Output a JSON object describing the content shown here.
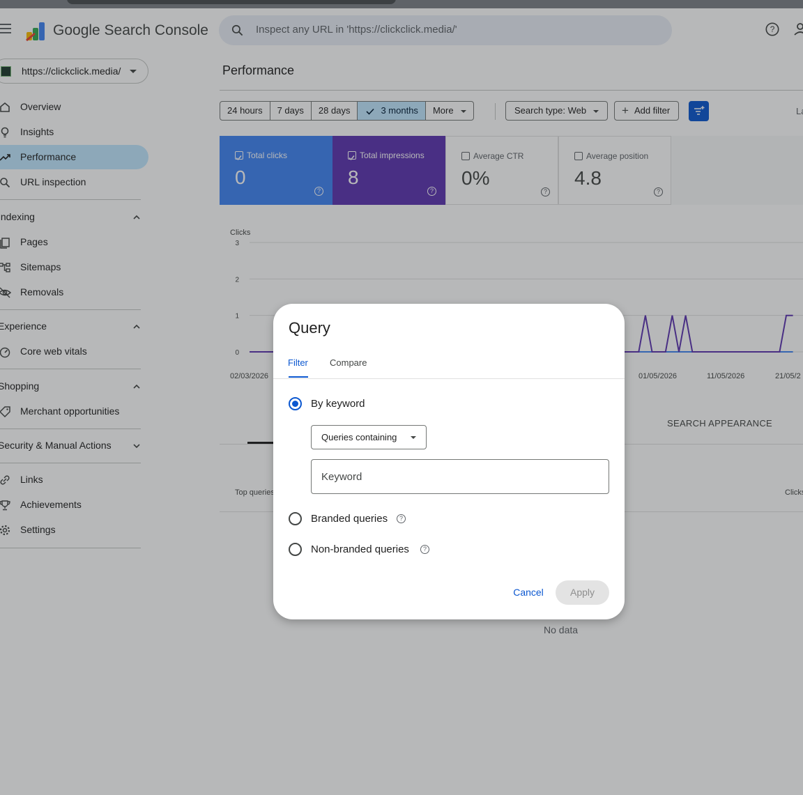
{
  "header": {
    "brand": "Google Search Console",
    "search_placeholder": "Inspect any URL in 'https://clickclick.media/'"
  },
  "sidebar": {
    "property": "https://clickclick.media/",
    "items": [
      {
        "label": "Overview",
        "icon": "home-icon"
      },
      {
        "label": "Insights",
        "icon": "lightbulb-icon"
      },
      {
        "label": "Performance",
        "icon": "trending-up-icon",
        "active": true
      },
      {
        "label": "URL inspection",
        "icon": "search-icon"
      }
    ],
    "sections": [
      {
        "title": "Indexing",
        "items": [
          "Pages",
          "Sitemaps",
          "Removals"
        ]
      },
      {
        "title": "Experience",
        "items": [
          "Core web vitals"
        ]
      },
      {
        "title": "Shopping",
        "items": [
          "Merchant opportunities"
        ]
      },
      {
        "title": "Security & Manual Actions",
        "items": []
      }
    ],
    "bottom_items": [
      "Links",
      "Achievements",
      "Settings"
    ]
  },
  "main": {
    "title": "Performance",
    "ranges": [
      "24 hours",
      "7 days",
      "28 days",
      "3 months",
      "More"
    ],
    "selected_range": "3 months",
    "search_type": "Search type: Web",
    "add_filter": "Add filter",
    "last_updated_partial": "La",
    "metrics": [
      {
        "label": "Total clicks",
        "value": "0",
        "checked": true,
        "color": "#4285f4"
      },
      {
        "label": "Total impressions",
        "value": "8",
        "checked": true,
        "color": "#5e35b1"
      },
      {
        "label": "Average CTR",
        "value": "0%",
        "checked": false
      },
      {
        "label": "Average position",
        "value": "4.8",
        "checked": false
      }
    ]
  },
  "chart_data": {
    "type": "line",
    "ylabel": "Clicks",
    "ylim": [
      0,
      3
    ],
    "y_ticks": [
      "0",
      "1",
      "2",
      "3"
    ],
    "x_tick_labels": [
      "02/03/2026",
      "01/05/2026",
      "11/05/2026",
      "21/05/2"
    ],
    "series": [
      {
        "color": "#5e35b1",
        "points": [
          [
            "02/03/2026",
            0
          ],
          [
            "29/04/2026",
            0
          ],
          [
            "30/04/2026",
            1
          ],
          [
            "01/05/2026",
            0
          ],
          [
            "03/05/2026",
            0
          ],
          [
            "04/05/2026",
            1
          ],
          [
            "05/05/2026",
            0
          ],
          [
            "06/05/2026",
            1
          ],
          [
            "07/05/2026",
            0
          ],
          [
            "20/05/2026",
            0
          ],
          [
            "21/05/2026",
            1
          ],
          [
            "22/05/2026",
            1
          ]
        ]
      },
      {
        "color": "#4285f4",
        "points": [
          [
            "02/03/2026",
            0
          ],
          [
            "22/05/2026",
            0
          ]
        ]
      }
    ]
  },
  "table": {
    "tab_search_appearance": "SEARCH APPEARANCE",
    "top_queries": "Top queries",
    "clicks_col": "Clicks",
    "no_data": "No data"
  },
  "dialog": {
    "title": "Query",
    "tabs": [
      "Filter",
      "Compare"
    ],
    "active_tab": "Filter",
    "options": [
      {
        "label": "By keyword",
        "selected": true
      },
      {
        "label": "Branded queries",
        "selected": false
      },
      {
        "label": "Non-branded queries",
        "selected": false
      }
    ],
    "match_type": "Queries containing",
    "keyword_placeholder": "Keyword",
    "cancel": "Cancel",
    "apply": "Apply"
  }
}
